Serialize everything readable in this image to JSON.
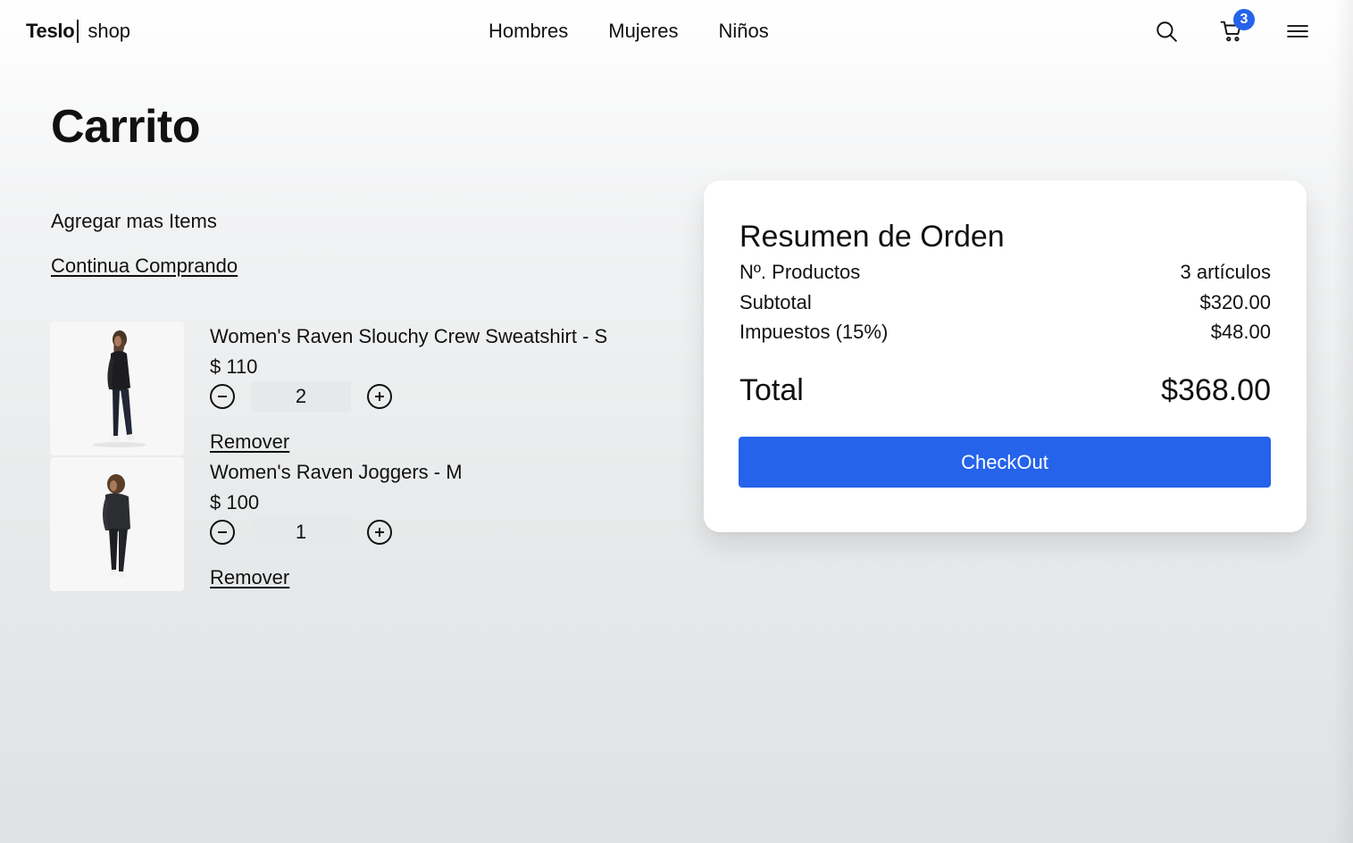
{
  "header": {
    "brand": "Teslo",
    "brand_suffix": "shop",
    "nav": [
      "Hombres",
      "Mujeres",
      "Niños"
    ],
    "cart_count": "3",
    "icons": [
      "search-icon",
      "cart-icon",
      "menu-icon"
    ]
  },
  "page": {
    "title": "Carrito",
    "add_items": "Agregar mas Items",
    "continue_link": "Continua Comprando"
  },
  "cart": {
    "items": [
      {
        "name": "Women's Raven Slouchy Crew Sweatshirt - S",
        "price": "$ 110",
        "quantity": "2",
        "remove": "Remover"
      },
      {
        "name": "Women's Raven Joggers - M",
        "price": "$ 100",
        "quantity": "1",
        "remove": "Remover"
      }
    ]
  },
  "summary": {
    "title": "Resumen de Orden",
    "products_label": "Nº. Productos",
    "products_value": "3 artículos",
    "subtotal_label": "Subtotal",
    "subtotal_value": "$320.00",
    "tax_label": "Impuestos (15%)",
    "tax_value": "$48.00",
    "total_label": "Total",
    "total_value": "$368.00",
    "checkout_label": "CheckOut"
  },
  "colors": {
    "accent": "#2563eb"
  }
}
